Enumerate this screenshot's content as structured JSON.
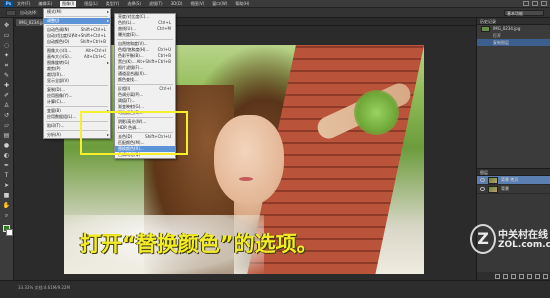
{
  "menubar": {
    "logo": "Ps",
    "items": [
      "文件(F)",
      "编辑(E)",
      "图像(I)",
      "图层(L)",
      "类型(Y)",
      "选择(S)",
      "滤镜(T)",
      "3D(D)",
      "视图(V)",
      "窗口(W)",
      "帮助(H)"
    ],
    "active_index": 2
  },
  "optionsbar": {
    "labels": [
      "自动选择：",
      "图层",
      "显示变换控件"
    ],
    "workspace": "基本功能"
  },
  "tab": {
    "label": "IMG_0234.jpg @ 33.3%(RGB/8)"
  },
  "image_menu": {
    "rows": [
      {
        "label": "模式(M)",
        "arrow": "▸"
      },
      {
        "sep": true
      },
      {
        "label": "调整(J)",
        "arrow": "▸",
        "selected": true
      },
      {
        "sep": true
      },
      {
        "label": "自动色调(N)",
        "shortcut": "Shift+Ctrl+L"
      },
      {
        "label": "自动对比度(U)",
        "shortcut": "Alt+Shift+Ctrl+L"
      },
      {
        "label": "自动颜色(O)",
        "shortcut": "Shift+Ctrl+B"
      },
      {
        "sep": true
      },
      {
        "label": "图像大小(I)...",
        "shortcut": "Alt+Ctrl+I"
      },
      {
        "label": "画布大小(S)...",
        "shortcut": "Alt+Ctrl+C"
      },
      {
        "label": "图像旋转(G)",
        "arrow": "▸"
      },
      {
        "label": "裁剪(P)"
      },
      {
        "label": "裁切(R)..."
      },
      {
        "label": "显示全部(V)"
      },
      {
        "sep": true
      },
      {
        "label": "复制(D)..."
      },
      {
        "label": "应用图像(Y)..."
      },
      {
        "label": "计算(C)..."
      },
      {
        "sep": true
      },
      {
        "label": "变量(B)",
        "arrow": "▸"
      },
      {
        "label": "应用数据组(L)..."
      },
      {
        "sep": true
      },
      {
        "label": "陷印(T)..."
      },
      {
        "sep": true
      },
      {
        "label": "分析(A)",
        "arrow": "▸"
      }
    ]
  },
  "adjust_menu": {
    "rows": [
      {
        "label": "亮度/对比度(C)..."
      },
      {
        "label": "色阶(L)...",
        "shortcut": "Ctrl+L"
      },
      {
        "label": "曲线(U)...",
        "shortcut": "Ctrl+M"
      },
      {
        "label": "曝光度(E)..."
      },
      {
        "sep": true
      },
      {
        "label": "自然饱和度(V)..."
      },
      {
        "label": "色相/饱和度(H)...",
        "shortcut": "Ctrl+U"
      },
      {
        "label": "色彩平衡(B)...",
        "shortcut": "Ctrl+B"
      },
      {
        "label": "黑白(K)...",
        "shortcut": "Alt+Shift+Ctrl+B"
      },
      {
        "label": "照片滤镜(F)..."
      },
      {
        "label": "通道混合器(X)..."
      },
      {
        "label": "颜色查找..."
      },
      {
        "sep": true
      },
      {
        "label": "反相(I)",
        "shortcut": "Ctrl+I"
      },
      {
        "label": "色调分离(P)..."
      },
      {
        "label": "阈值(T)..."
      },
      {
        "label": "渐变映射(G)..."
      },
      {
        "label": "可选颜色(S)..."
      },
      {
        "sep": true
      },
      {
        "label": "阴影/高光(W)..."
      },
      {
        "label": "HDR 色调..."
      },
      {
        "sep": true
      },
      {
        "label": "去色(D)",
        "shortcut": "Shift+Ctrl+U"
      },
      {
        "label": "匹配颜色(M)..."
      },
      {
        "label": "替换颜色(R)...",
        "selected": true
      },
      {
        "label": "色调均化(Q)"
      }
    ]
  },
  "caption": "打开“替换颜色”的选项。",
  "right_panel": {
    "history_header": "历史记录",
    "history": [
      "IMG_0234.jpg",
      "打开",
      "复制图层"
    ],
    "layers_header": "图层",
    "layers": [
      {
        "name": "背景 拷贝",
        "selected": true
      },
      {
        "name": "背景",
        "selected": false
      }
    ]
  },
  "status": "33.33%    文档:4.61M/9.22M",
  "watermark": {
    "cn": "中关村在线",
    "url": "ZOL.com.cn",
    "logo": "Z"
  },
  "colors": {
    "caption": "#f4ec24",
    "highlight_box": "#f6f02a",
    "menu_selected": "#5d94d8"
  }
}
